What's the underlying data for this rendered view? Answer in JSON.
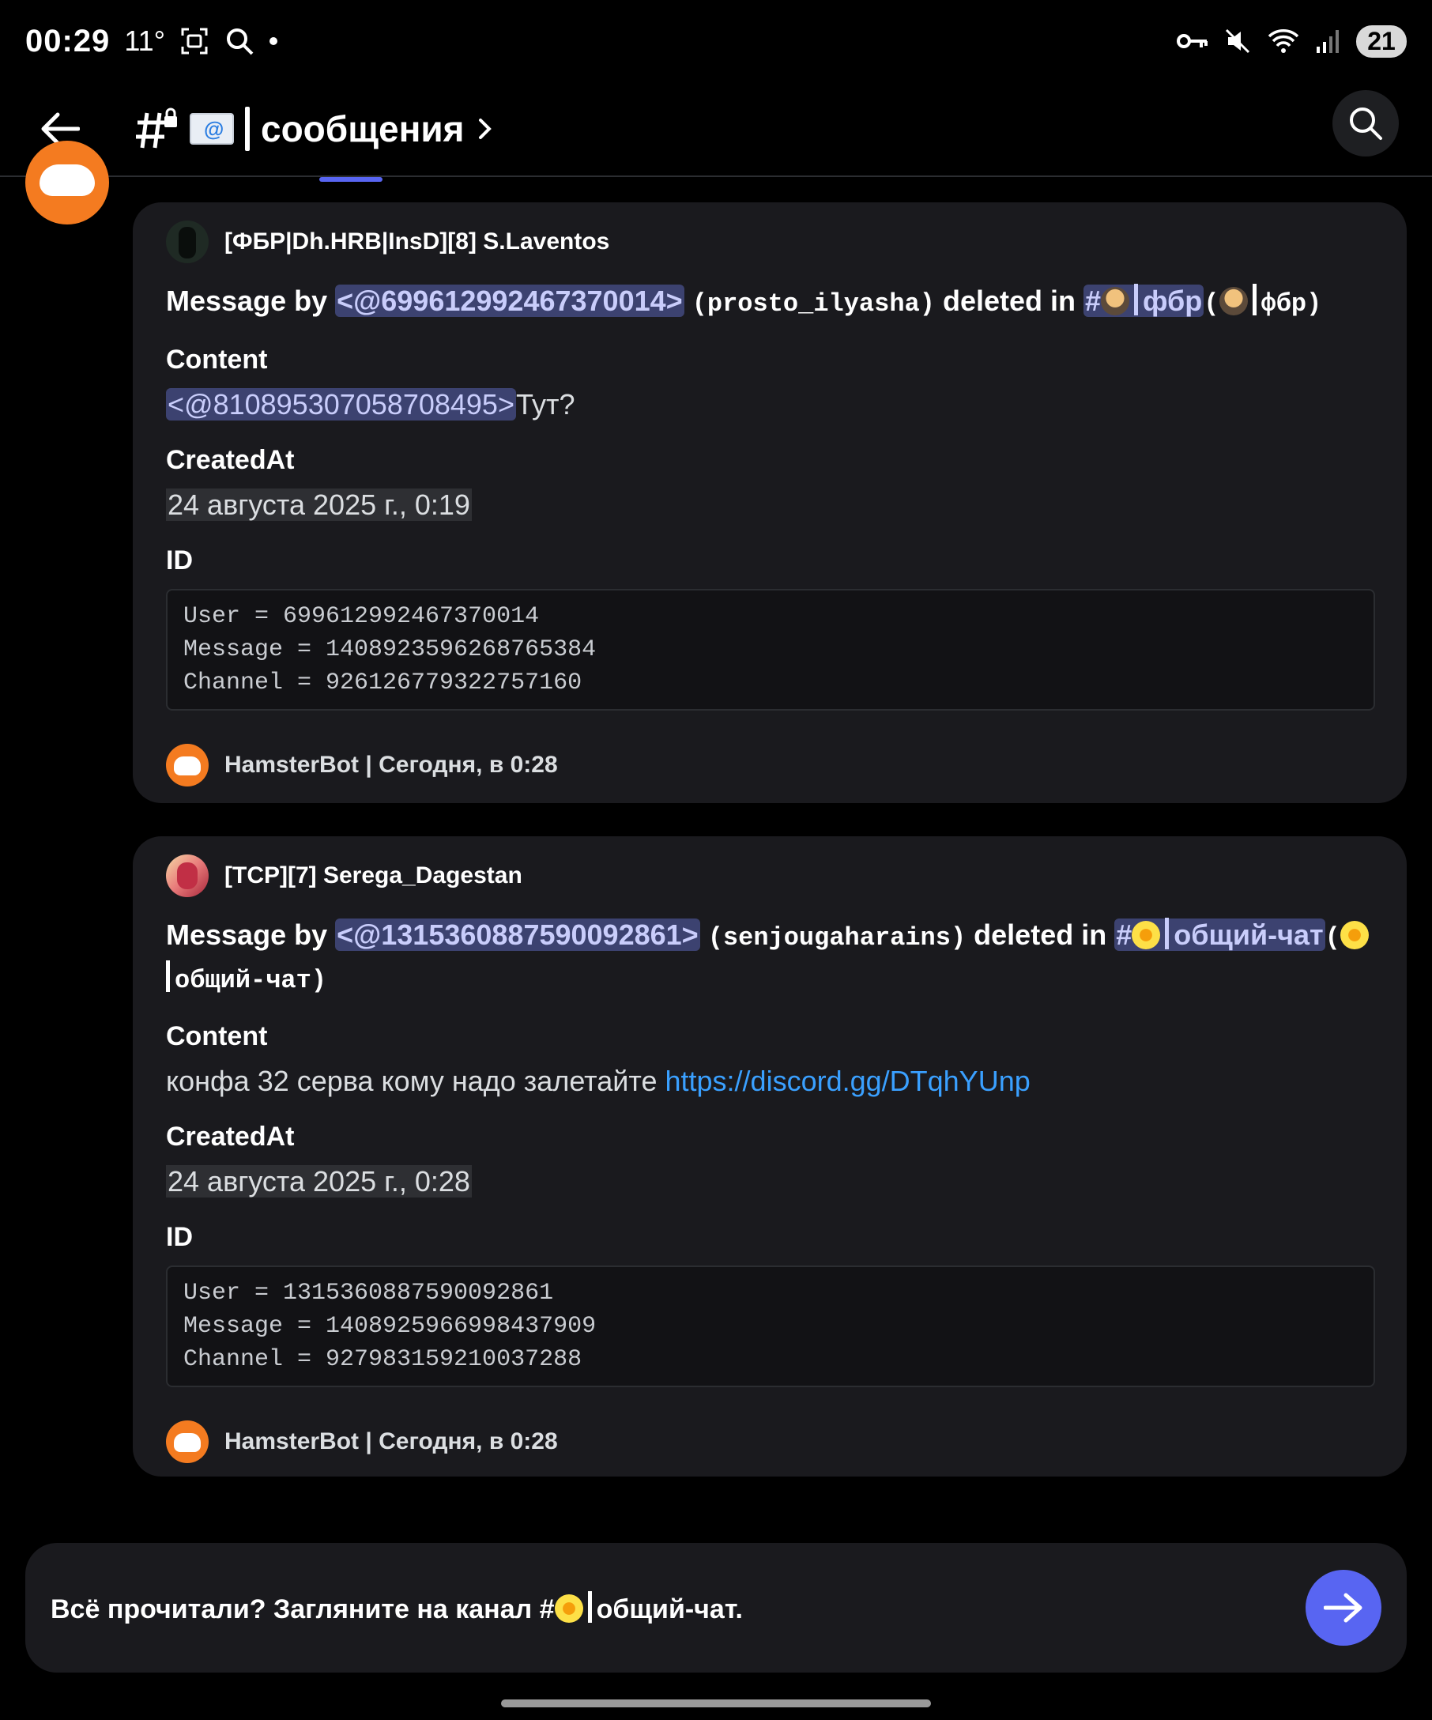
{
  "status_bar": {
    "time": "00:29",
    "temp": "11°",
    "battery": "21"
  },
  "header": {
    "channel_name": "сообщения"
  },
  "embeds": [
    {
      "author": "[ФБР|Dh.HRB|InsD][8] S.Laventos",
      "title_prefix": "Message by",
      "user_mention": "<@699612992467370014>",
      "username": "(prosto_ilyasha)",
      "deleted_in": "deleted in",
      "channel_hash": "#",
      "channel_name": "фбр",
      "channel_paren_name": "фбр)",
      "content_label": "Content",
      "content_mention": "<@810895307058708495>",
      "content_text": "Тут?",
      "created_label": "CreatedAt",
      "created_value": "24 августа 2025 г., 0:19",
      "id_label": "ID",
      "id_lines": [
        "User = 699612992467370014",
        "Message = 1408923596268765384",
        "Channel = 926126779322757160"
      ],
      "footer": "HamsterBot | Сегодня, в 0:28"
    },
    {
      "author": "[TCP][7] Serega_Dagestan",
      "title_prefix": "Message by",
      "user_mention": "<@1315360887590092861>",
      "username": "(senjougaharains)",
      "deleted_in": "deleted in",
      "channel_hash": "#",
      "channel_name": "общий-чат",
      "channel_paren_name": "общий-чат)",
      "content_label": "Content",
      "content_text": "конфа 32 серва кому надо залетайте",
      "content_link": "https://discord.gg/DTqhYUnp",
      "created_label": "CreatedAt",
      "created_value": "24 августа 2025 г., 0:28",
      "id_label": "ID",
      "id_lines": [
        "User = 1315360887590092861",
        "Message = 1408925966998437909",
        "Channel = 927983159210037288"
      ],
      "footer": "HamsterBot | Сегодня, в 0:28"
    }
  ],
  "banner": {
    "text_before": "Всё прочитали? Загляните на канал #",
    "channel_name": "общий-чат."
  },
  "colors": {
    "mention_bg": "#3c4270",
    "link": "#3aa0ff",
    "accent": "#5865f2",
    "bot_avatar": "#f47b20"
  }
}
